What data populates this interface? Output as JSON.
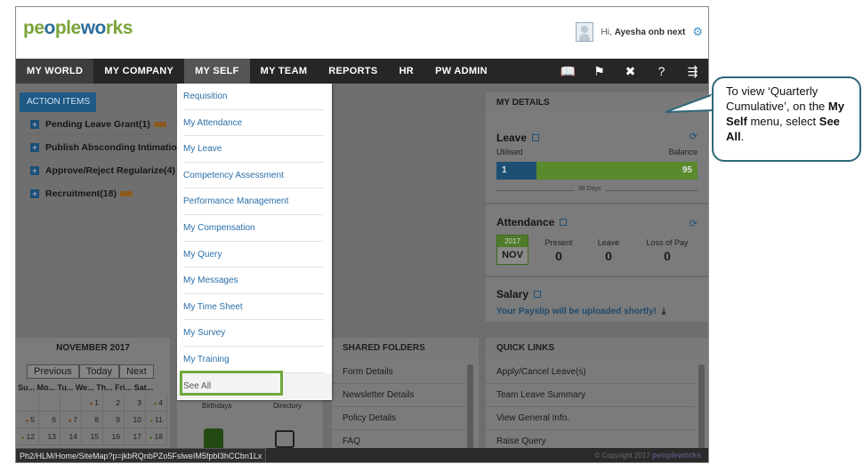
{
  "header": {
    "logo_part1": "pe",
    "logo_part2": "o",
    "logo_part3": "ple",
    "logo_part4": "w",
    "logo_part5": "o",
    "logo_part6": "rks",
    "greeting": "Hi,",
    "user_name": "Ayesha onb next"
  },
  "nav": {
    "items": [
      "MY WORLD",
      "MY COMPANY",
      "MY SELF",
      "MY TEAM",
      "REPORTS",
      "HR",
      "PW ADMIN"
    ]
  },
  "action_items": {
    "tab": "ACTION ITEMS",
    "rows": [
      "Pending Leave Grant(1)",
      "Publish Absconding Intimation L",
      "Approve/Reject Regularize(4)",
      "Recruitment(18)"
    ]
  },
  "my_details": {
    "title": "MY DETAILS",
    "leave": {
      "title": "Leave",
      "utilised_label": "Utilised",
      "balance_label": "Balance",
      "utilised": "1",
      "balance": "95",
      "utilised_fraction": 0.2,
      "total_label": "96 Days"
    },
    "attendance": {
      "title": "Attendance",
      "year": "2017",
      "month": "NOV",
      "present_label": "Present",
      "present": "0",
      "leave_label": "Leave",
      "leave": "0",
      "lop_label": "Loss of Pay",
      "lop": "0"
    },
    "salary": {
      "title": "Salary",
      "note": "Your Payslip will be uploaded shortly!"
    }
  },
  "calendar": {
    "month": "NOVEMBER 2017",
    "prev": "Previous",
    "today": "Today",
    "next": "Next",
    "weekdays": "Su... Mo... Tu... We... Th... Fri... Sat...",
    "rows": [
      [
        "",
        "",
        "",
        "1",
        "2",
        "3",
        "4"
      ],
      [
        "5",
        "6",
        "7",
        "8",
        "9",
        "10",
        "11"
      ],
      [
        "12",
        "13",
        "14",
        "15",
        "16",
        "17",
        "18"
      ]
    ]
  },
  "widgets": {
    "birthdays": "Birthdays",
    "directory": "Directory"
  },
  "shared_folders": {
    "title": "SHARED FOLDERS",
    "items": [
      "Form Details",
      "Newsletter Details",
      "Policy Details",
      "FAQ"
    ]
  },
  "quick_links": {
    "title": "QUICK LINKS",
    "items": [
      "Apply/Cancel Leave(s)",
      "Team Leave Summary",
      "View General Info.",
      "Raise Query"
    ]
  },
  "dropdown": {
    "items": [
      "Requisition",
      "My Attendance",
      "My Leave",
      "Competency Assessment",
      "Performance Management",
      "My Compensation",
      "My Query",
      "My Messages",
      "My Time Sheet",
      "My Survey",
      "My Training"
    ],
    "see_all": "See All"
  },
  "footer": {
    "copyright": "© Copyright 2017",
    "brand": "peopleworks",
    "url": "Ph2/HLM/Home/SiteMap?p=jkbRQnbPZo5FslweIM5fpbI3hCCbn1Lx"
  },
  "callout": {
    "text1": "To view ‘Quarterly Cumulative’, on the ",
    "bold1": "My Self",
    "text2": " menu, select ",
    "bold2": "See All",
    "text3": "."
  },
  "colors": {
    "accent_green": "#7aa43a",
    "accent_blue": "#2c6e9b",
    "nav_bg": "#262626",
    "link_blue": "#2a6fa8",
    "highlight_green": "#6fa93c"
  }
}
